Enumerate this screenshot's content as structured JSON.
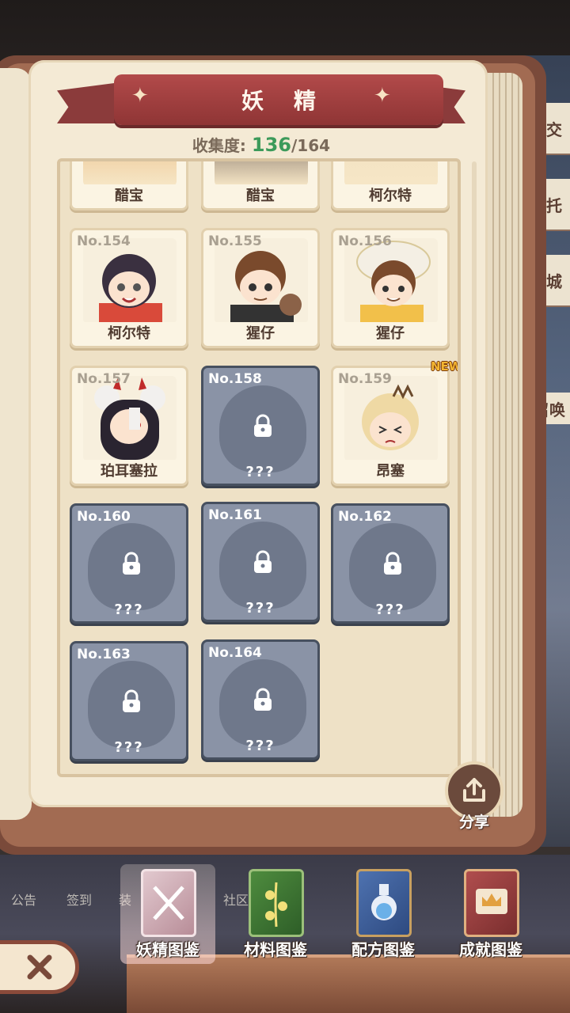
{
  "header": {
    "title": "妖 精",
    "collection_label": "收集度:",
    "collection_current": "136",
    "collection_total": "/164"
  },
  "side_tags": [
    "交",
    "托",
    "城"
  ],
  "summon_tag": "召唤",
  "cards_top_row": [
    {
      "name": "醋宝"
    },
    {
      "name": "醋宝"
    },
    {
      "name": "柯尔特"
    }
  ],
  "cards": [
    {
      "no": "No.154",
      "name": "柯尔特",
      "locked": false
    },
    {
      "no": "No.155",
      "name": "猩仔",
      "locked": false
    },
    {
      "no": "No.156",
      "name": "猩仔",
      "locked": false
    },
    {
      "no": "No.157",
      "name": "珀耳塞拉",
      "locked": false
    },
    {
      "no": "No.158",
      "name": "???",
      "locked": true
    },
    {
      "no": "No.159",
      "name": "昂塞",
      "locked": false,
      "badge": "NEW"
    },
    {
      "no": "No.160",
      "name": "???",
      "locked": true
    },
    {
      "no": "No.161",
      "name": "???",
      "locked": true
    },
    {
      "no": "No.162",
      "name": "???",
      "locked": true
    },
    {
      "no": "No.163",
      "name": "???",
      "locked": true
    },
    {
      "no": "No.164",
      "name": "???",
      "locked": true
    }
  ],
  "share": {
    "label": "分享"
  },
  "background_nav": [
    "公告",
    "签到",
    "装",
    "社区"
  ],
  "tabs": [
    {
      "label": "妖精图鉴",
      "active": true
    },
    {
      "label": "材料图鉴",
      "active": false
    },
    {
      "label": "配方图鉴",
      "active": false
    },
    {
      "label": "成就图鉴",
      "active": false
    }
  ],
  "colors": {
    "ribbon": "#a94444",
    "page": "#f4ead5",
    "locked_card": "#8a93a6",
    "collection_current": "#3c9a5a"
  }
}
